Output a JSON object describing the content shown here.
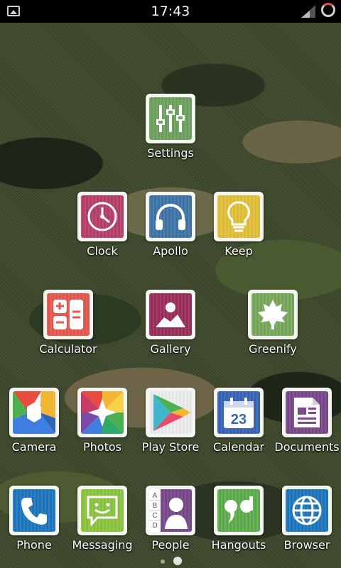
{
  "status_bar": {
    "time": "17:43"
  },
  "apps": {
    "settings": "Settings",
    "clock": "Clock",
    "apollo": "Apollo",
    "keep": "Keep",
    "calculator": "Calculator",
    "gallery": "Gallery",
    "greenify": "Greenify",
    "camera": "Camera",
    "photos": "Photos",
    "play_store": "Play Store",
    "calendar": "Calendar",
    "calendar_day": "23",
    "documents": "Documents",
    "phone": "Phone",
    "messaging": "Messaging",
    "people": "People",
    "people_letters": [
      "A",
      "B",
      "C",
      "D"
    ],
    "hangouts": "Hangouts",
    "browser": "Browser"
  },
  "page_indicator": {
    "pages": 2,
    "current": 2
  },
  "colors": {
    "settings": "#6fa35f",
    "clock": "#b8406a",
    "apollo": "#3f76a8",
    "keep": "#e4c23a",
    "calculator": "#e8574f",
    "gallery": "#9b2f5c",
    "greenify": "#7aaa5c",
    "calendar": "#3a64b8",
    "documents": "#7a4a8c",
    "phone": "#1e78c0",
    "messaging": "#8cc63f",
    "people": "#7a4a8c",
    "hangouts": "#5fae4e",
    "browser": "#1e78c0"
  }
}
